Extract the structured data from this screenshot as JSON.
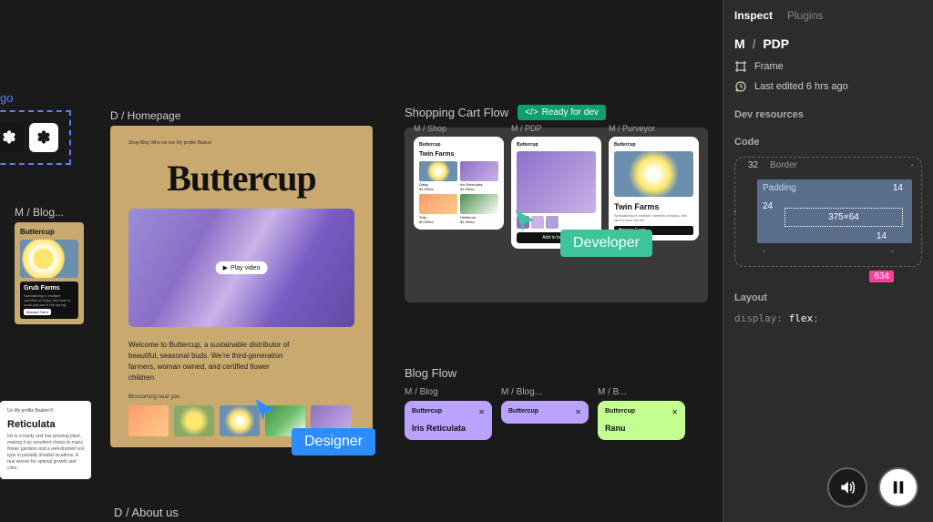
{
  "logo": {
    "label": "go",
    "glyph": "✽"
  },
  "leftblog": {
    "label": "M / Blog...",
    "brand": "Buttercup",
    "card_title": "Grub Farms",
    "card_text": "Specializing in multiple varieties of tulips, this farm is most popular in the spring.",
    "card_btn": "Browse Farm"
  },
  "bottomleft": {
    "header": "Us   My profile   Basket 0",
    "title": "Reticulata",
    "text": "Iris is a hardy and low-growing plant, making it an excellent choice in many flower gardens and a well-drained soil type in partially shaded locations. A real winner for optimal growth and color."
  },
  "homepage": {
    "label": "D / Homepage",
    "nav": "Shop   Blog   Who we are   My profile   Basket",
    "title": "Buttercup",
    "play": "Play video",
    "tagline": "Welcome to Buttercup, a sustainable distributor of beautiful, seasonal buds. We're third-generation farmers, woman owned, and certified flower children.",
    "subhead": "Blossoming near you"
  },
  "aboutus": {
    "label": "D / About us"
  },
  "cart": {
    "label": "Shopping Cart Flow",
    "badge": "Ready for dev",
    "shop": {
      "label": "M / Shop",
      "brand": "Buttercup",
      "heading": "Twin Farms",
      "items": [
        {
          "name": "Daisy",
          "price": "$1.99/ea"
        },
        {
          "name": "Iris Reticulata",
          "price": "$1.99/ea"
        },
        {
          "name": "Tulip",
          "price": "$0.99/ea"
        },
        {
          "name": "Hellebore",
          "price": "$1.49/ea"
        }
      ]
    },
    "pdp": {
      "label": "M / PDP",
      "brand": "Buttercup",
      "btn": "Add to basket"
    },
    "purveyor": {
      "label": "M / Purveyor",
      "brand": "Buttercup",
      "title": "Twin Farms",
      "text": "Specializing in multiple varieties of tulips, this farm's reds can be",
      "btn": "Browse Farm"
    }
  },
  "cursors": {
    "designer": "Designer",
    "developer": "Developer"
  },
  "blogflow": {
    "label": "Blog Flow",
    "cards": [
      {
        "label": "M / Blog",
        "brand": "Buttercup",
        "title": "Iris Reticulata"
      },
      {
        "label": "M / Blog...",
        "brand": "Buttercup",
        "title": ""
      },
      {
        "label": "M / B...",
        "brand": "Buttercup",
        "title": "Ranu"
      }
    ]
  },
  "sidebar": {
    "tabs": {
      "inspect": "Inspect",
      "plugins": "Plugins"
    },
    "crumb": {
      "a": "M",
      "b": "PDP"
    },
    "frame": "Frame",
    "edited": "Last edited 6 hrs ago",
    "dev_resources": "Dev resources",
    "code": "Code",
    "box": {
      "border_label": "Border",
      "border_top": "32",
      "padding_label": "Padding",
      "pad_top": "14",
      "pad_left": "24",
      "pad_bottom": "14",
      "content": "375×64",
      "dash": "-",
      "pink": "634"
    },
    "layout": "Layout",
    "codeline": {
      "prop": "display",
      "val": "flex"
    }
  },
  "media": {
    "sound": "sound",
    "pause": "pause"
  }
}
